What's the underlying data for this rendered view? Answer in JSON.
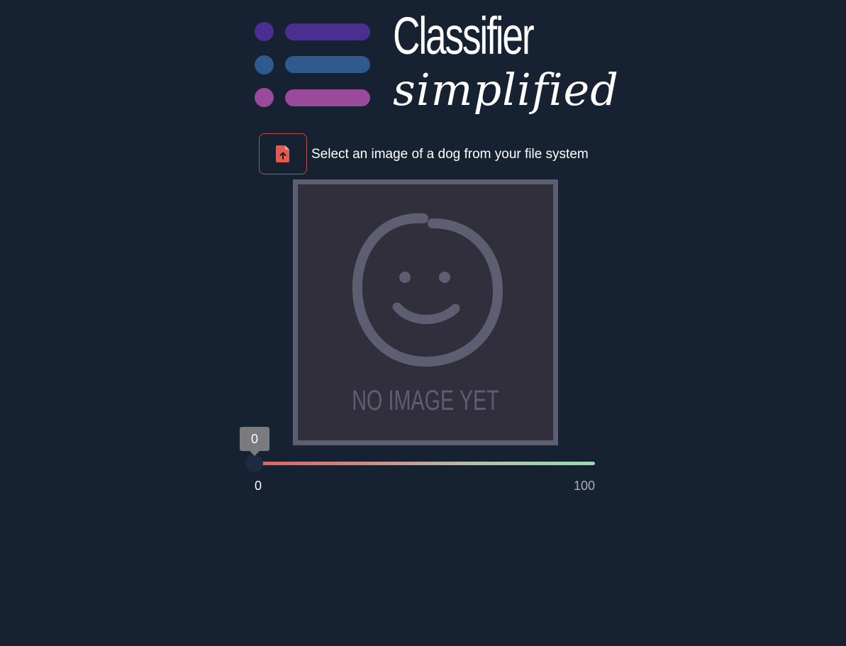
{
  "logo": {
    "title": "Classifier",
    "subtitle": "simplified",
    "colors": [
      "#4b2f90",
      "#2e5a8e",
      "#9a4a9b"
    ]
  },
  "upload": {
    "icon": "file-upload-icon",
    "label": "Select an image of a dog from your file system",
    "accent": "#e8584f"
  },
  "placeholder": {
    "icon": "smiley-face-icon",
    "text": "NO IMAGE YET"
  },
  "slider": {
    "value": 0,
    "value_label": "0",
    "min_label": "0",
    "max_label": "100",
    "min": 0,
    "max": 100
  }
}
